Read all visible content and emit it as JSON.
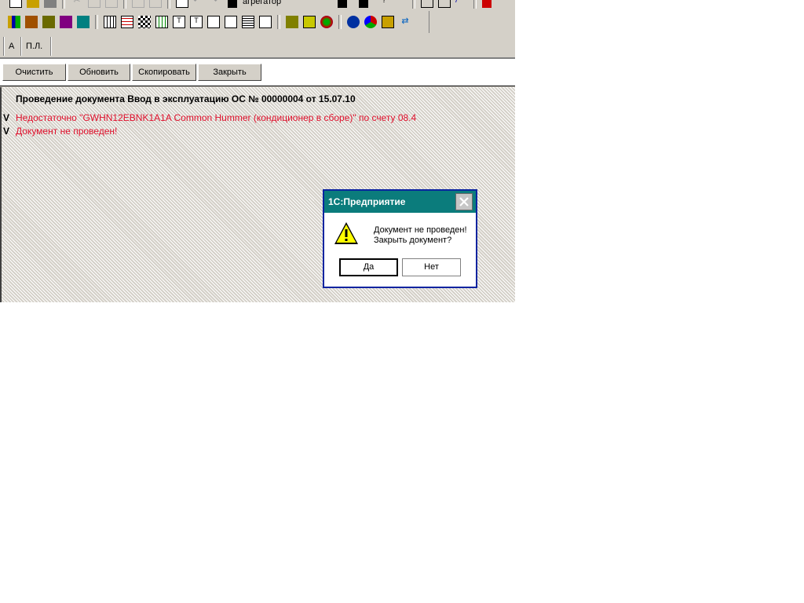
{
  "toolbar": {
    "combo_text": "агрегатор",
    "row1_icons": [
      "new-icon",
      "open-icon",
      "save-icon",
      "cut-icon",
      "copy-icon",
      "paste-icon",
      "print-preview-icon",
      "print-icon",
      "find-icon",
      "undo-icon",
      "redo-icon",
      "binoculars-icon",
      "binoculars-icon",
      "binoculars-icon",
      "help-cursor-icon",
      "calculator-icon",
      "calendar-icon",
      "magic-icon",
      "journal-icon"
    ],
    "row2_icons": [
      "chart-of-accounts-icon",
      "operations-icon",
      "journal-book-icon",
      "delete-marked-icon",
      "filter-icon",
      "table-icon",
      "table-icon",
      "checker-icon",
      "report-icon",
      "text-icon",
      "text-icon",
      "report-icon",
      "report-icon",
      "document-icon",
      "chart-icon",
      "tools-icon",
      "monitor-icon",
      "globe-icon",
      "arrows-icon",
      "settings-icon",
      "messages-icon",
      "refresh-icon"
    ]
  },
  "tabs": [
    {
      "label": "А"
    },
    {
      "label": "П.Л."
    }
  ],
  "buttons": {
    "clear": "Очистить",
    "refresh": "Обновить",
    "copy": "Скопировать",
    "close": "Закрыть"
  },
  "log": {
    "title": "Проведение документа Ввод в эксплуатацию ОС № 00000004 от 15.07.10",
    "entries": [
      {
        "mark": "V",
        "text": "Недостаточно \"GWHN12EBNK1A1A Common Hummer (кондиционер в сборе)\" по счету 08.4"
      },
      {
        "mark": "V",
        "text": "Документ не проведен!"
      }
    ]
  },
  "dialog": {
    "title": "1С:Предприятие",
    "line1": "Документ не проведен!",
    "line2": "Закрыть документ?",
    "yes": "Да",
    "no": "Нет",
    "icon": "warning-icon"
  },
  "colors": {
    "dialog_title_bg": "#0b7c7c",
    "dialog_border": "#0a24a0",
    "error_text": "#e0102c"
  }
}
